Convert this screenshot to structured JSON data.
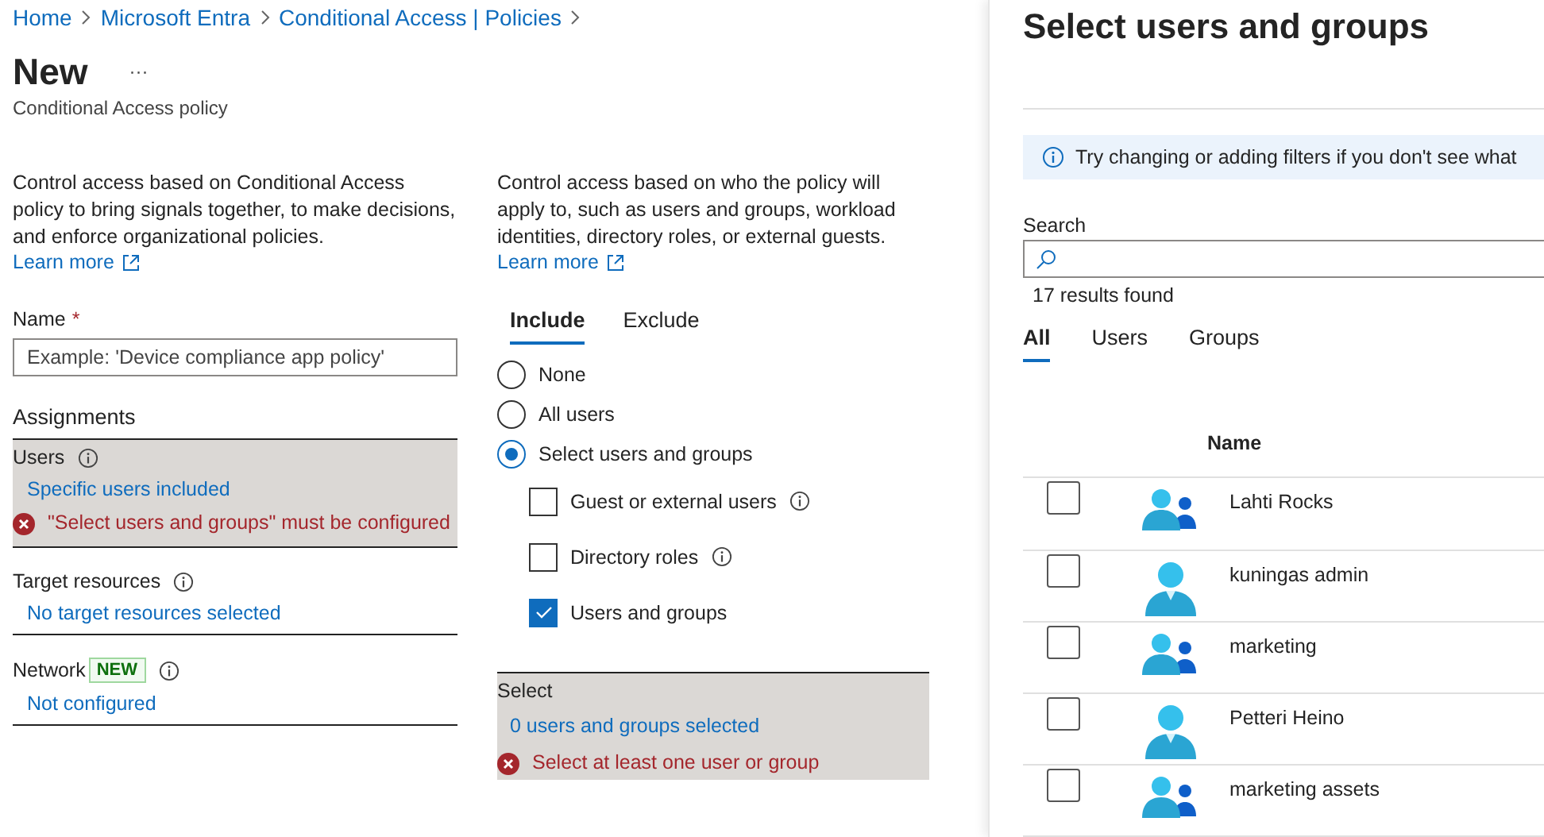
{
  "breadcrumb": [
    "Home",
    "Microsoft Entra",
    "Conditional Access | Policies"
  ],
  "page": {
    "title": "New",
    "more": "···",
    "subtitle": "Conditional Access policy"
  },
  "left": {
    "description": "Control access based on Conditional Access policy to bring signals together, to make decisions, and enforce organizational policies.",
    "learn_more": "Learn more",
    "name_field": {
      "label": "Name",
      "required": "*",
      "placeholder": "Example: 'Device compliance app policy'"
    },
    "section": "Assignments",
    "items": [
      {
        "label": "Users",
        "info": true,
        "value": "Specific users included",
        "selected": true,
        "error": "\"Select users and groups\" must be configured"
      },
      {
        "label": "Target resources",
        "info": true,
        "value": "No target resources selected",
        "selected": false
      },
      {
        "label": "Network",
        "badge": "NEW",
        "info": true,
        "value": "Not configured",
        "selected": false
      }
    ]
  },
  "middle": {
    "description": "Control access based on who the policy will apply to, such as users and groups, workload identities, directory roles, or external guests.",
    "learn_more": "Learn more",
    "tabs": [
      {
        "label": "Include",
        "selected": true
      },
      {
        "label": "Exclude",
        "selected": false
      }
    ],
    "radios": [
      {
        "label": "None",
        "selected": false
      },
      {
        "label": "All users",
        "selected": false
      },
      {
        "label": "Select users and groups",
        "selected": true
      }
    ],
    "checkboxes": [
      {
        "label": "Guest or external users",
        "info": true,
        "checked": false
      },
      {
        "label": "Directory roles",
        "info": true,
        "checked": false
      },
      {
        "label": "Users and groups",
        "checked": true
      }
    ],
    "select": {
      "label": "Select",
      "value": "0 users and groups selected",
      "error": "Select at least one user or group"
    }
  },
  "panel": {
    "title": "Select users and groups",
    "info": "Try changing or adding filters if you don't see what",
    "search": {
      "label": "Search"
    },
    "results": "17 results found",
    "tabs": [
      {
        "label": "All",
        "selected": true
      },
      {
        "label": "Users",
        "selected": false
      },
      {
        "label": "Groups",
        "selected": false
      }
    ],
    "column": "Name",
    "rows": [
      {
        "name": "Lahti Rocks",
        "kind": "group",
        "checked": false
      },
      {
        "name": "kuningas admin",
        "kind": "user",
        "checked": false
      },
      {
        "name": "marketing",
        "kind": "group",
        "checked": false
      },
      {
        "name": "Petteri Heino",
        "kind": "user",
        "checked": false
      },
      {
        "name": "marketing assets",
        "kind": "group",
        "checked": false
      }
    ]
  }
}
